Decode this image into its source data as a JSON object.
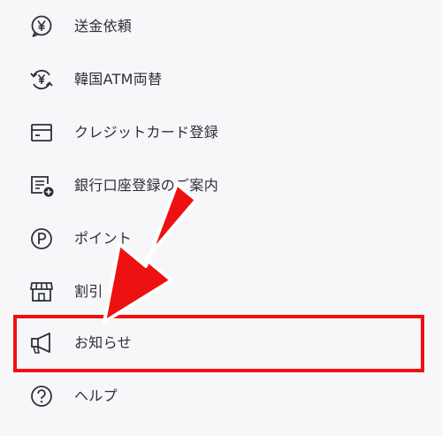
{
  "menu": {
    "items": [
      {
        "label": "送金依頼",
        "icon": "yen-speech-bubble-icon"
      },
      {
        "label": "韓国ATM両替",
        "icon": "yen-exchange-icon"
      },
      {
        "label": "クレジットカード登録",
        "icon": "credit-card-icon"
      },
      {
        "label": "銀行口座登録のご案内",
        "icon": "bank-card-add-icon"
      },
      {
        "label": "ポイント",
        "icon": "point-circle-icon"
      },
      {
        "label": "割引",
        "icon": "store-icon"
      },
      {
        "label": "お知らせ",
        "icon": "megaphone-icon"
      },
      {
        "label": "ヘルプ",
        "icon": "help-circle-icon"
      }
    ]
  },
  "colors": {
    "text": "#2b2f3a",
    "icon": "#2b2f3a",
    "annotation": "#ee1111",
    "background": "#f7f7f9"
  }
}
